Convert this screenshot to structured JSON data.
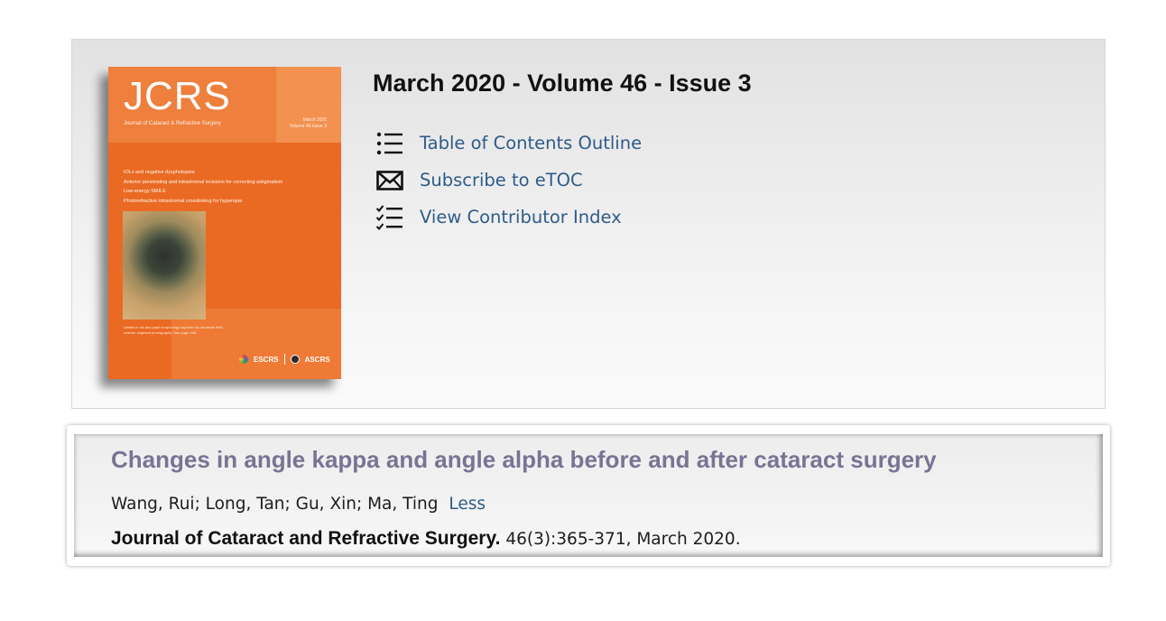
{
  "issue": {
    "title": "March 2020 - Volume 46 - Issue 3",
    "cover": {
      "logo": "JCRS",
      "subtitle": "Journal of Cataract & Refractive Surgery",
      "date_line1": "March 2020",
      "date_line2": "Volume 46 Issue 3",
      "toc_lines": [
        "IOLs and negative dysphotopsia",
        "Anterior penetrating and intrastromal incisions for correcting astigmatism",
        "Low-energy SMILE",
        "Photorefractive intrastromal crosslinking for hyperopia"
      ],
      "caption_line1": "Details in iris and pupil morphology captured by ultrawide field",
      "caption_line2": "anterior segment photography. See page 448.",
      "org_logo_1": "ESCRS",
      "org_logo_2": "ASCRS"
    },
    "links": [
      {
        "label": "Table of Contents Outline",
        "icon": "list-icon"
      },
      {
        "label": "Subscribe to eTOC",
        "icon": "envelope-icon"
      },
      {
        "label": "View Contributor Index",
        "icon": "checklist-icon"
      }
    ]
  },
  "article": {
    "title": "Changes in angle kappa and angle alpha before and after cataract surgery",
    "authors": "Wang, Rui; Long, Tan; Gu, Xin; Ma, Ting",
    "authors_toggle": "Less",
    "journal": "Journal of Cataract and Refractive Surgery.",
    "citation": "46(3):365-371, March 2020."
  },
  "colors": {
    "link": "#2e5b8a",
    "article_title": "#7a7394",
    "cover_orange": "#ea6a23"
  }
}
